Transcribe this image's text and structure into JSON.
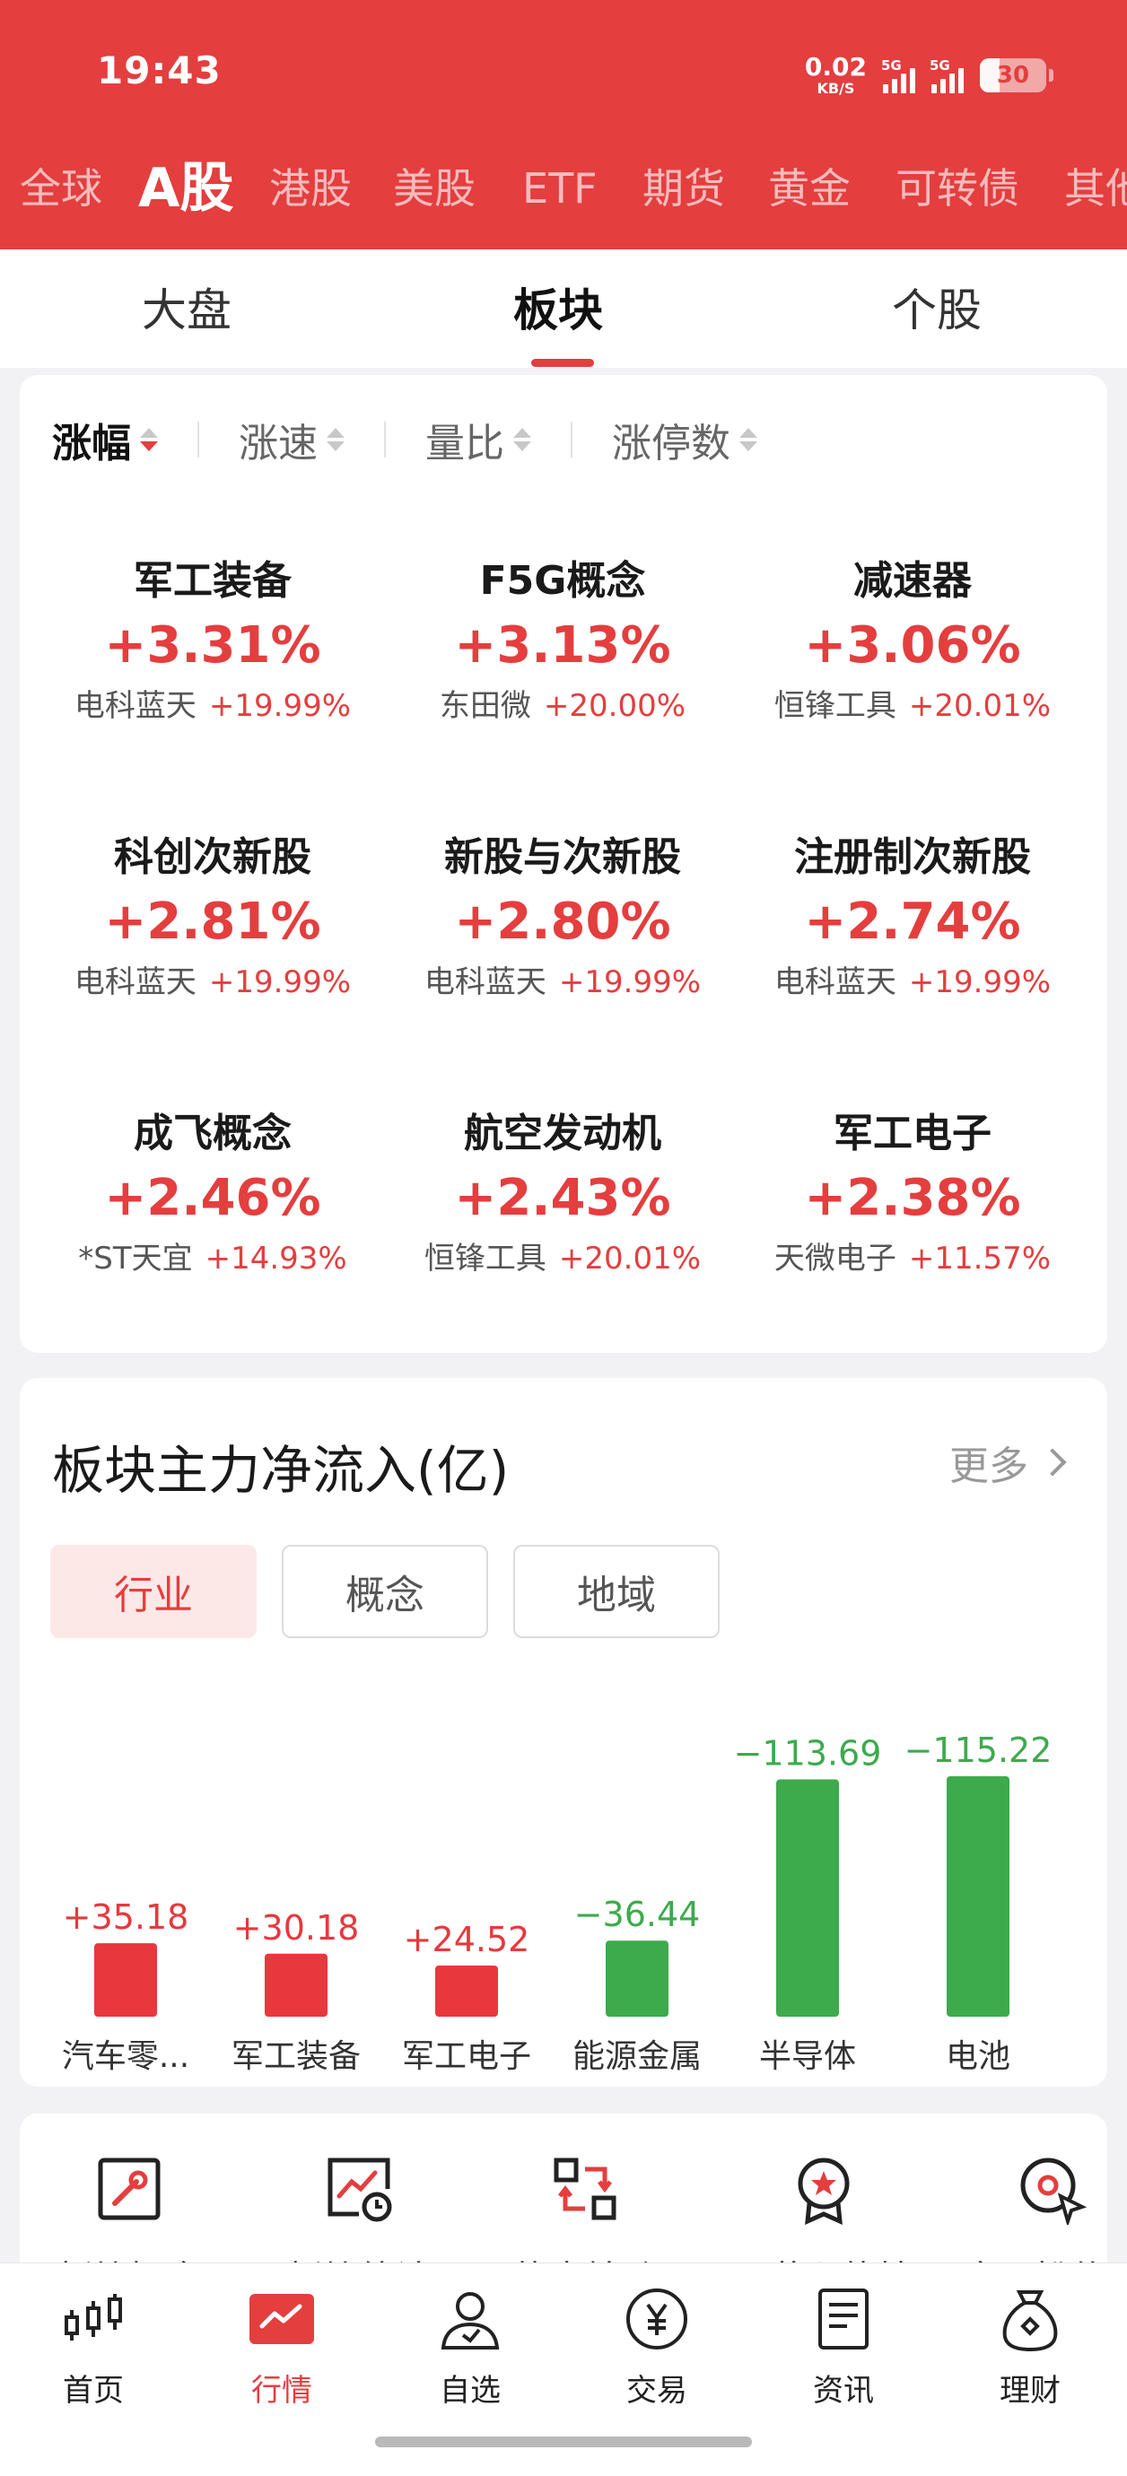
{
  "status_bar": {
    "time": "19:43",
    "net_speed_value": "0.02",
    "net_speed_unit": "KB/S",
    "sim1_label": "5G",
    "sim2_label": "5G",
    "battery_level": "30",
    "battery_fraction": 0.3
  },
  "market_tabs": [
    {
      "label": "全球"
    },
    {
      "label": "A股",
      "active": true
    },
    {
      "label": "港股"
    },
    {
      "label": "美股"
    },
    {
      "label": "ETF"
    },
    {
      "label": "期货"
    },
    {
      "label": "黄金"
    },
    {
      "label": "可转债"
    },
    {
      "label": "其他"
    }
  ],
  "sub_tabs": [
    {
      "label": "大盘"
    },
    {
      "label": "板块",
      "active": true
    },
    {
      "label": "个股"
    }
  ],
  "sort_options": [
    {
      "label": "涨幅",
      "active": true
    },
    {
      "label": "涨速"
    },
    {
      "label": "量比"
    },
    {
      "label": "涨停数"
    }
  ],
  "sectors": [
    {
      "name": "军工装备",
      "change": "+3.31%",
      "leader": "电科蓝天",
      "leader_change": "+19.99%"
    },
    {
      "name": "F5G概念",
      "change": "+3.13%",
      "leader": "东田微",
      "leader_change": "+20.00%"
    },
    {
      "name": "减速器",
      "change": "+3.06%",
      "leader": "恒锋工具",
      "leader_change": "+20.01%"
    },
    {
      "name": "科创次新股",
      "change": "+2.81%",
      "leader": "电科蓝天",
      "leader_change": "+19.99%"
    },
    {
      "name": "新股与次新股",
      "change": "+2.80%",
      "leader": "电科蓝天",
      "leader_change": "+19.99%"
    },
    {
      "name": "注册制次新股",
      "change": "+2.74%",
      "leader": "电科蓝天",
      "leader_change": "+19.99%"
    },
    {
      "name": "成飞概念",
      "change": "+2.46%",
      "leader": "*ST天宜",
      "leader_change": "+14.93%"
    },
    {
      "name": "航空发动机",
      "change": "+2.43%",
      "leader": "恒锋工具",
      "leader_change": "+20.01%"
    },
    {
      "name": "军工电子",
      "change": "+2.38%",
      "leader": "天微电子",
      "leader_change": "+11.57%"
    }
  ],
  "flow": {
    "title": "板块主力净流入(亿)",
    "more_label": "更多",
    "tabs": [
      {
        "label": "行业",
        "active": true
      },
      {
        "label": "概念"
      },
      {
        "label": "地域"
      }
    ]
  },
  "chart_data": {
    "type": "bar",
    "categories": [
      "汽车零...",
      "军工装备",
      "军工电子",
      "能源金属",
      "半导体",
      "电池"
    ],
    "values": [
      35.18,
      30.18,
      24.52,
      -36.44,
      -113.69,
      -115.22
    ],
    "value_labels": [
      "+35.18",
      "+30.18",
      "+24.52",
      "−36.44",
      "−113.69",
      "−115.22"
    ],
    "title": "板块主力净流入(亿)",
    "positive_color": "#e8383d",
    "negative_color": "#3daa4c",
    "grid": false,
    "legend": "none"
  },
  "tools": [
    {
      "label": "板块掘金",
      "icon": "board-gold-icon"
    },
    {
      "label": "板块统计",
      "icon": "board-stats-icon"
    },
    {
      "label": "热点轮动",
      "icon": "hot-rotation-icon"
    },
    {
      "label": "同花顺热榜",
      "icon": "hot-list-icon"
    },
    {
      "label": "金工粉什么",
      "icon": "search-target-icon"
    }
  ],
  "bottom_nav": [
    {
      "label": "首页",
      "icon": "candlestick-icon"
    },
    {
      "label": "行情",
      "icon": "market-chart-icon",
      "active": true
    },
    {
      "label": "自选",
      "icon": "user-star-icon"
    },
    {
      "label": "交易",
      "icon": "yen-coin-icon"
    },
    {
      "label": "资讯",
      "icon": "news-doc-icon"
    },
    {
      "label": "理财",
      "icon": "money-bag-icon"
    }
  ],
  "colors": {
    "brand": "#e43e3f",
    "up": "#e8383d",
    "down": "#3daa4c"
  }
}
